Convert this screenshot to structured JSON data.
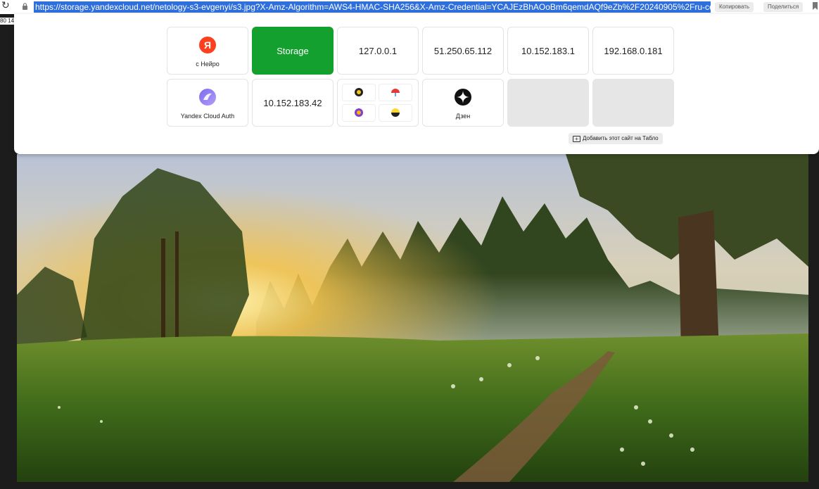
{
  "browser": {
    "url": "https://storage.yandexcloud.net/netology-s3-evgenyi/s3.jpg?X-Amz-Algorithm=AWS4-HMAC-SHA256&X-Amz-Credential=YCAJEzBhAOoBm6qemdAQf9eZb%2F20240905%2Fru-central1%2",
    "copy_label": "Копировать",
    "share_label": "Поделиться",
    "side_text": "80 14"
  },
  "tablo": {
    "tiles": [
      {
        "label": "с Нейро",
        "icon": "yandex-ya-icon"
      },
      {
        "label": "Storage"
      },
      {
        "label": "127.0.0.1"
      },
      {
        "label": "51.250.65.112"
      },
      {
        "label": "10.152.183.1"
      },
      {
        "label": "192.168.0.181"
      },
      {
        "label": "Yandex Cloud Auth",
        "icon": "yandex-cloud-auth-icon"
      },
      {
        "label": "10.152.183.42"
      },
      {
        "label": "",
        "icon": "app-group-icon"
      },
      {
        "label": "Дзен",
        "icon": "dzen-icon"
      },
      {
        "label": ""
      },
      {
        "label": ""
      }
    ],
    "add_site_label": "Добавить этот сайт на Табло"
  },
  "colors": {
    "accent_green": "#14a02e",
    "url_highlight": "#2f6fdb",
    "yandex_red": "#fc3f1d"
  }
}
